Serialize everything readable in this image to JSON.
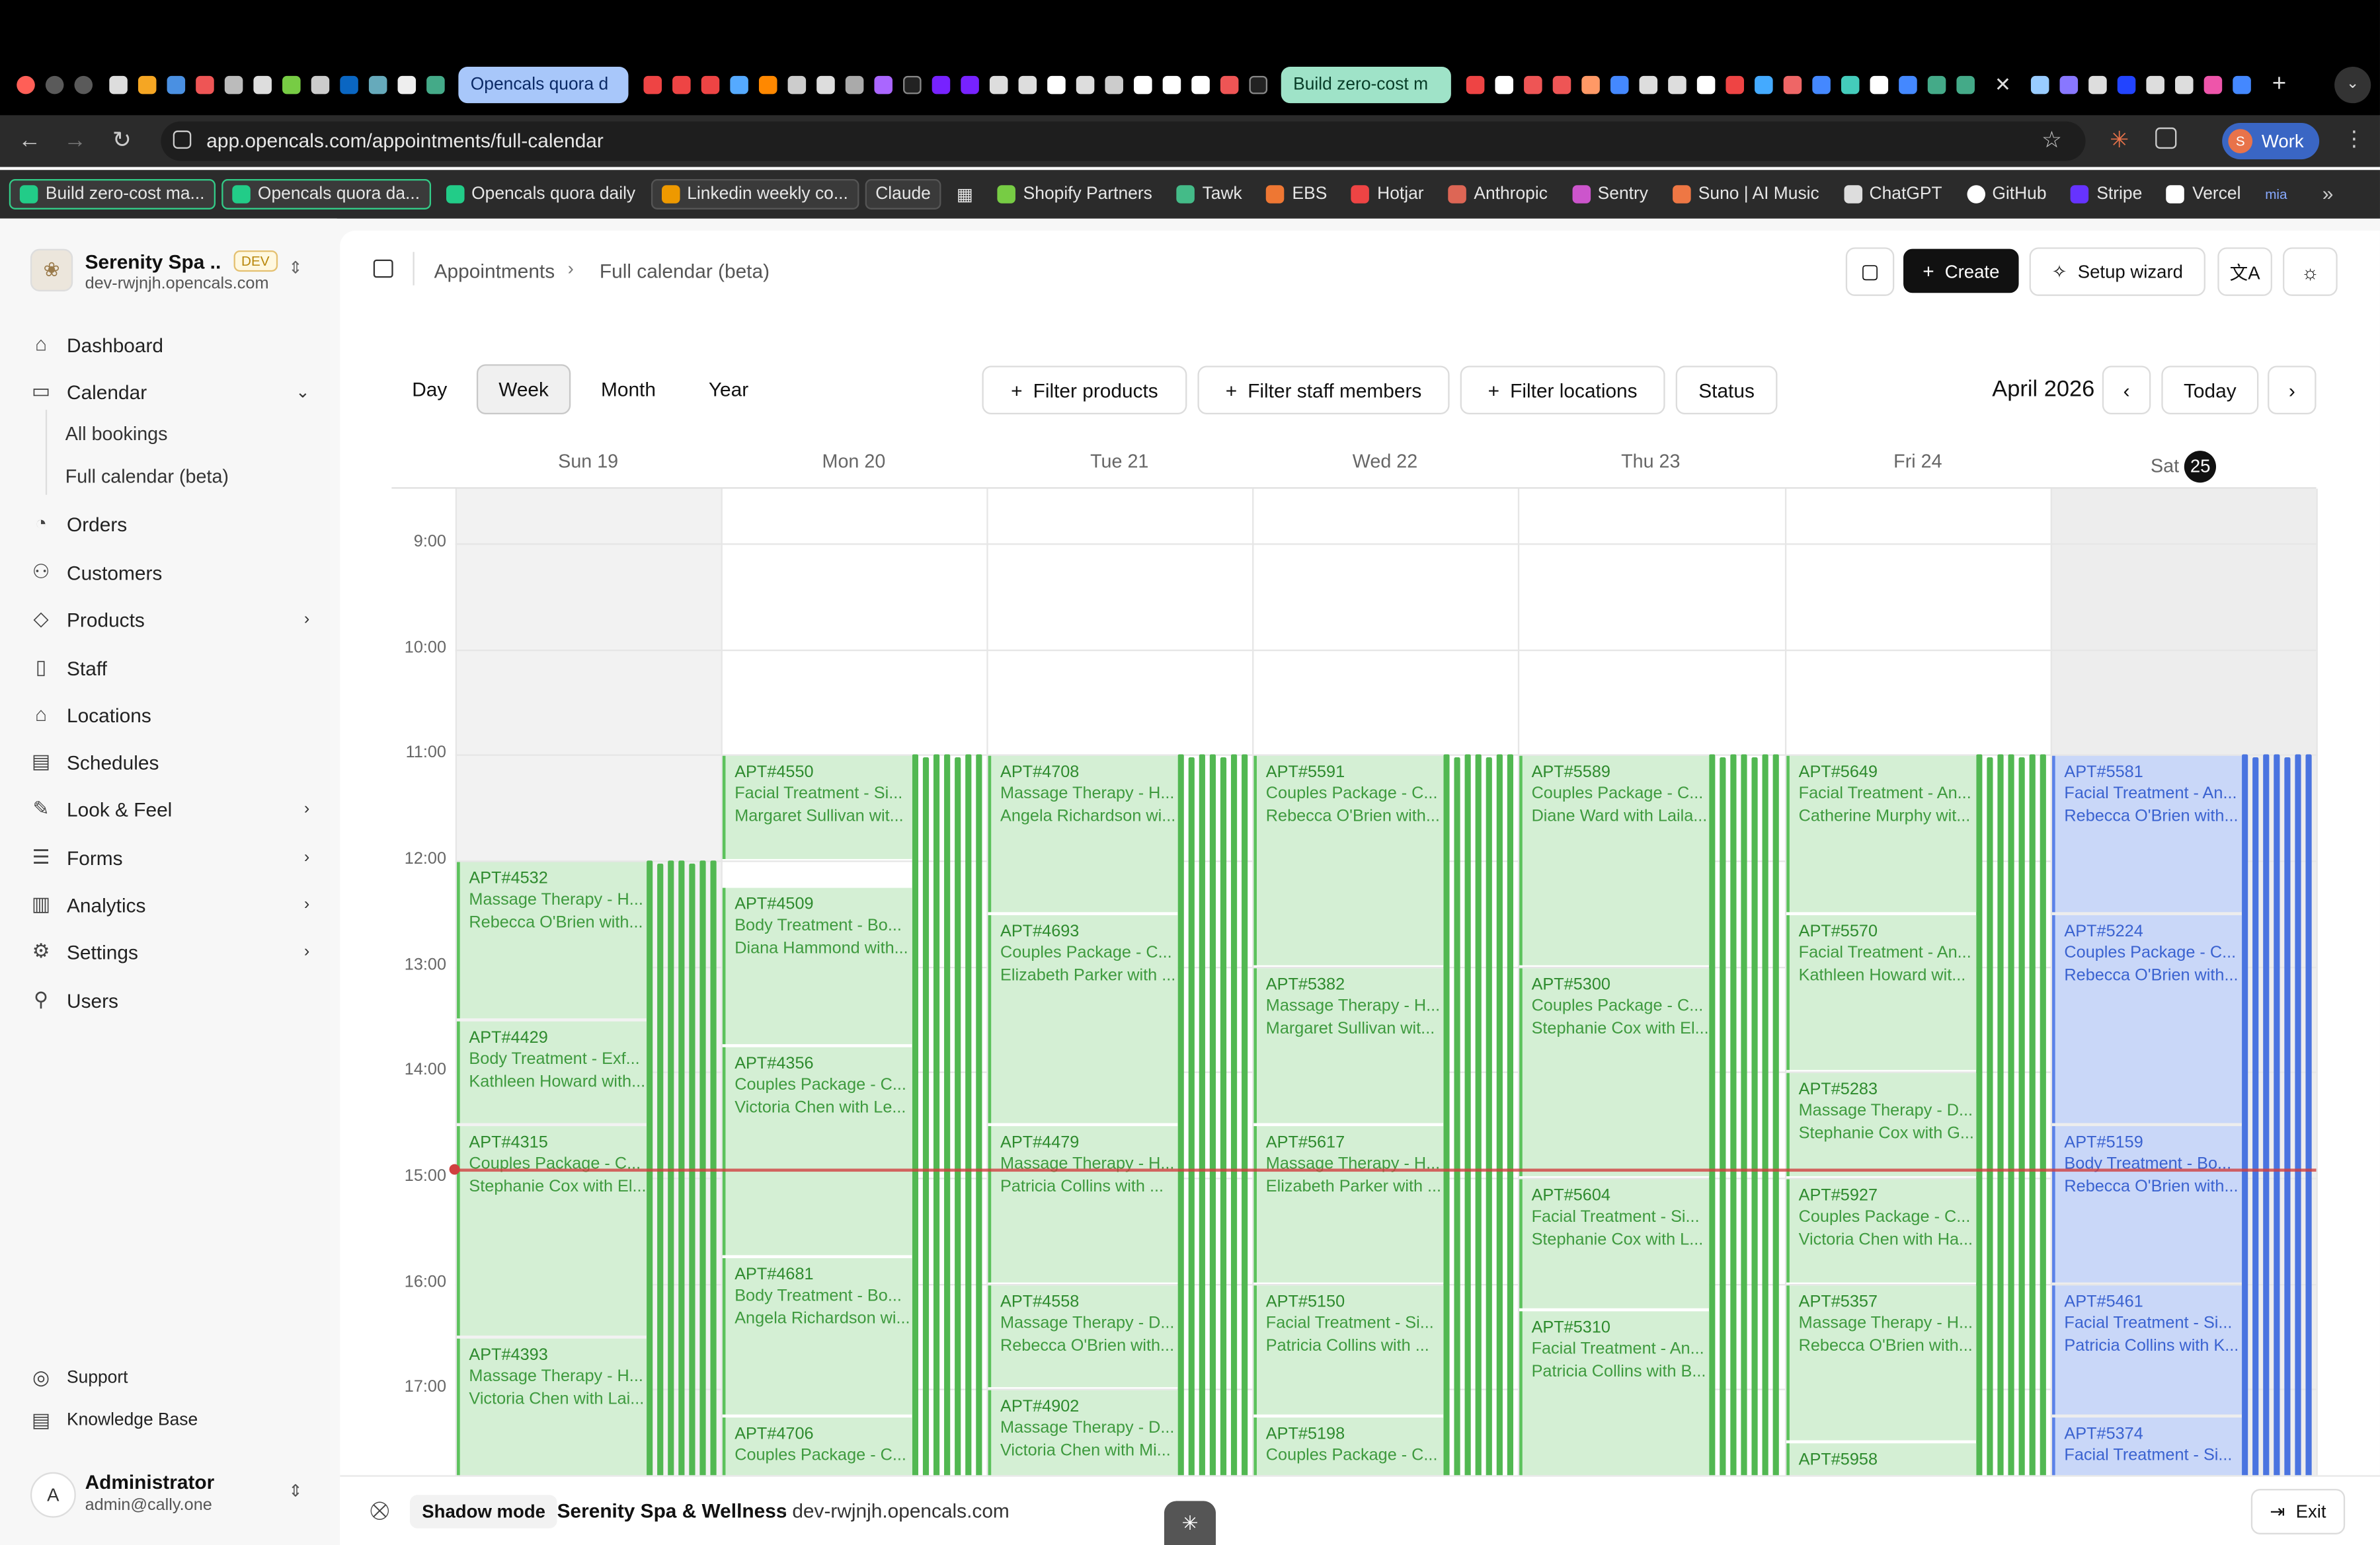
{
  "browser": {
    "tabs": [
      {
        "label": "Opencals quora d",
        "color": "#a8c7fa"
      },
      {
        "label": "Build zero-cost m",
        "color": "#9fe3c8"
      }
    ],
    "url": "app.opencals.com/appointments/full-calendar",
    "profile": "Work",
    "bookmarks": [
      "Build zero-cost ma...",
      "Opencals quora da...",
      "Opencals quora daily",
      "Linkedin weekly co...",
      "Claude",
      "Shopify Partners",
      "Tawk",
      "EBS",
      "Hotjar",
      "Anthropic",
      "Sentry",
      "Suno | AI Music",
      "ChatGPT",
      "GitHub",
      "Stripe",
      "Vercel",
      "mia"
    ]
  },
  "workspace": {
    "name": "Serenity Spa ...",
    "badge": "DEV",
    "domain": "dev-rwjnjh.opencals.com"
  },
  "nav": {
    "dashboard": "Dashboard",
    "calendar": "Calendar",
    "all_bookings": "All bookings",
    "full_calendar": "Full calendar (beta)",
    "orders": "Orders",
    "customers": "Customers",
    "products": "Products",
    "staff": "Staff",
    "locations": "Locations",
    "schedules": "Schedules",
    "look_feel": "Look & Feel",
    "forms": "Forms",
    "analytics": "Analytics",
    "settings": "Settings",
    "users": "Users",
    "support": "Support",
    "knowledge_base": "Knowledge Base"
  },
  "user": {
    "initial": "A",
    "name": "Administrator",
    "email": "admin@cally.one"
  },
  "header": {
    "breadcrumb_1": "Appointments",
    "breadcrumb_2": "Full calendar (beta)",
    "create": "Create",
    "setup_wizard": "Setup wizard"
  },
  "toolbar": {
    "views": [
      "Day",
      "Week",
      "Month",
      "Year"
    ],
    "active_view": "Week",
    "filter_products": "Filter products",
    "filter_staff": "Filter staff members",
    "filter_locations": "Filter locations",
    "status": "Status",
    "period": "April 2026",
    "today": "Today"
  },
  "calendar": {
    "days": [
      {
        "name": "Sun",
        "num": "19"
      },
      {
        "name": "Mon",
        "num": "20"
      },
      {
        "name": "Tue",
        "num": "21"
      },
      {
        "name": "Wed",
        "num": "22"
      },
      {
        "name": "Thu",
        "num": "23"
      },
      {
        "name": "Fri",
        "num": "24"
      },
      {
        "name": "Sat",
        "num": "25",
        "today": true
      }
    ],
    "hours": [
      "9:00",
      "10:00",
      "11:00",
      "12:00",
      "13:00",
      "14:00",
      "15:00",
      "16:00",
      "17:00"
    ],
    "now_time": "14:55",
    "events": [
      {
        "day": 0,
        "start": "12:00",
        "end": "13:30",
        "id": "APT#4532",
        "service": "Massage Therapy - H...",
        "who": "Rebecca O'Brien with..."
      },
      {
        "day": 0,
        "start": "13:30",
        "end": "14:30",
        "id": "APT#4429",
        "service": "Body Treatment - Exf...",
        "who": "Kathleen Howard with..."
      },
      {
        "day": 0,
        "start": "14:30",
        "end": "16:30",
        "id": "APT#4315",
        "service": "Couples Package - C...",
        "who": "Stephanie Cox with El..."
      },
      {
        "day": 0,
        "start": "16:30",
        "end": "18:00",
        "id": "APT#4393",
        "service": "Massage Therapy - H...",
        "who": "Victoria Chen with Lai..."
      },
      {
        "day": 1,
        "start": "11:00",
        "end": "12:00",
        "id": "APT#4550",
        "service": "Facial Treatment - Si...",
        "who": "Margaret Sullivan wit..."
      },
      {
        "day": 1,
        "start": "12:15",
        "end": "13:45",
        "id": "APT#4509",
        "service": "Body Treatment - Bo...",
        "who": "Diana Hammond with..."
      },
      {
        "day": 1,
        "start": "13:45",
        "end": "15:45",
        "id": "APT#4356",
        "service": "Couples Package - C...",
        "who": "Victoria Chen with Le..."
      },
      {
        "day": 1,
        "start": "15:45",
        "end": "17:15",
        "id": "APT#4681",
        "service": "Body Treatment - Bo...",
        "who": "Angela Richardson wi..."
      },
      {
        "day": 1,
        "start": "17:15",
        "end": "18:00",
        "id": "APT#4706",
        "service": "Couples Package - C...",
        "who": ""
      },
      {
        "day": 2,
        "start": "11:00",
        "end": "12:30",
        "id": "APT#4708",
        "service": "Massage Therapy - H...",
        "who": "Angela Richardson wi..."
      },
      {
        "day": 2,
        "start": "12:30",
        "end": "14:30",
        "id": "APT#4693",
        "service": "Couples Package - C...",
        "who": "Elizabeth Parker with ..."
      },
      {
        "day": 2,
        "start": "14:30",
        "end": "16:00",
        "id": "APT#4479",
        "service": "Massage Therapy - H...",
        "who": "Patricia Collins with ..."
      },
      {
        "day": 2,
        "start": "16:00",
        "end": "17:00",
        "id": "APT#4558",
        "service": "Massage Therapy - D...",
        "who": "Rebecca O'Brien with..."
      },
      {
        "day": 2,
        "start": "17:00",
        "end": "18:00",
        "id": "APT#4902",
        "service": "Massage Therapy - D...",
        "who": "Victoria Chen with Mi..."
      },
      {
        "day": 3,
        "start": "11:00",
        "end": "13:00",
        "id": "APT#5591",
        "service": "Couples Package - C...",
        "who": "Rebecca O'Brien with..."
      },
      {
        "day": 3,
        "start": "13:00",
        "end": "14:30",
        "id": "APT#5382",
        "service": "Massage Therapy - H...",
        "who": "Margaret Sullivan wit..."
      },
      {
        "day": 3,
        "start": "14:30",
        "end": "16:00",
        "id": "APT#5617",
        "service": "Massage Therapy - H...",
        "who": "Elizabeth Parker with ..."
      },
      {
        "day": 3,
        "start": "16:00",
        "end": "17:15",
        "id": "APT#5150",
        "service": "Facial Treatment - Si...",
        "who": "Patricia Collins with ..."
      },
      {
        "day": 3,
        "start": "17:15",
        "end": "18:00",
        "id": "APT#5198",
        "service": "Couples Package - C...",
        "who": ""
      },
      {
        "day": 4,
        "start": "11:00",
        "end": "13:00",
        "id": "APT#5589",
        "service": "Couples Package - C...",
        "who": "Diane Ward with Laila..."
      },
      {
        "day": 4,
        "start": "13:00",
        "end": "15:00",
        "id": "APT#5300",
        "service": "Couples Package - C...",
        "who": "Stephanie Cox with El..."
      },
      {
        "day": 4,
        "start": "15:00",
        "end": "16:15",
        "id": "APT#5604",
        "service": "Facial Treatment - Si...",
        "who": "Stephanie Cox with L..."
      },
      {
        "day": 4,
        "start": "16:15",
        "end": "18:00",
        "id": "APT#5310",
        "service": "Facial Treatment - An...",
        "who": "Patricia Collins with B..."
      },
      {
        "day": 5,
        "start": "11:00",
        "end": "12:30",
        "id": "APT#5649",
        "service": "Facial Treatment - An...",
        "who": "Catherine Murphy wit..."
      },
      {
        "day": 5,
        "start": "12:30",
        "end": "14:00",
        "id": "APT#5570",
        "service": "Facial Treatment - An...",
        "who": "Kathleen Howard wit..."
      },
      {
        "day": 5,
        "start": "14:00",
        "end": "15:00",
        "id": "APT#5283",
        "service": "Massage Therapy - D...",
        "who": "Stephanie Cox with G..."
      },
      {
        "day": 5,
        "start": "15:00",
        "end": "16:00",
        "id": "APT#5927",
        "service": "Couples Package - C...",
        "who": "Victoria Chen with Ha..."
      },
      {
        "day": 5,
        "start": "16:00",
        "end": "17:30",
        "id": "APT#5357",
        "service": "Massage Therapy - H...",
        "who": "Rebecca O'Brien with..."
      },
      {
        "day": 5,
        "start": "17:30",
        "end": "18:00",
        "id": "APT#5958",
        "service": "",
        "who": ""
      },
      {
        "day": 6,
        "start": "11:00",
        "end": "12:30",
        "id": "APT#5581",
        "service": "Facial Treatment - An...",
        "who": "Rebecca O'Brien with...",
        "color": "blue"
      },
      {
        "day": 6,
        "start": "12:30",
        "end": "14:30",
        "id": "APT#5224",
        "service": "Couples Package - C...",
        "who": "Rebecca O'Brien with...",
        "color": "blue"
      },
      {
        "day": 6,
        "start": "14:30",
        "end": "16:00",
        "id": "APT#5159",
        "service": "Body Treatment - Bo...",
        "who": "Rebecca O'Brien with...",
        "color": "blue"
      },
      {
        "day": 6,
        "start": "16:00",
        "end": "17:15",
        "id": "APT#5461",
        "service": "Facial Treatment - Si...",
        "who": "Patricia Collins with K...",
        "color": "blue"
      },
      {
        "day": 6,
        "start": "17:15",
        "end": "18:00",
        "id": "APT#5374",
        "service": "Facial Treatment - Si...",
        "who": "",
        "color": "blue"
      }
    ]
  },
  "footer": {
    "shadow_mode": "Shadow mode",
    "business": "Serenity Spa & Wellness",
    "domain": "- dev-rwjnjh.opencals.com",
    "exit": "Exit"
  },
  "colors": {
    "accent": "#111111",
    "event_green": "#d4efd4",
    "event_green_border": "#5cc25c",
    "event_blue": "#c9d7f8",
    "now_line": "#d04040"
  }
}
